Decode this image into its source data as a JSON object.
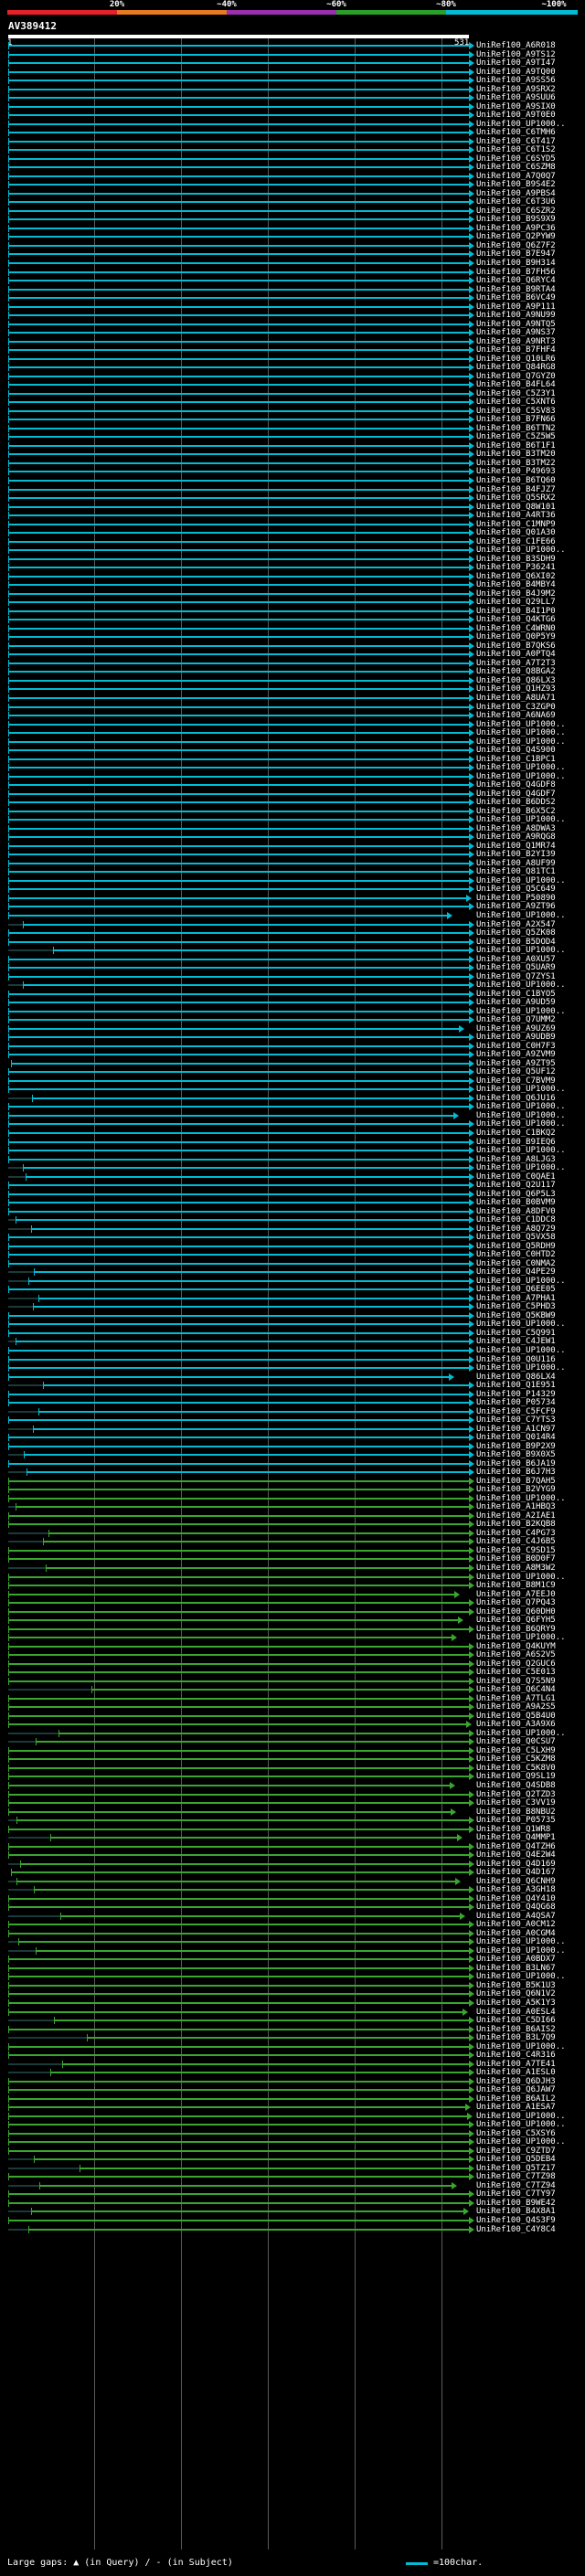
{
  "scale": {
    "marks": [
      "20%",
      "~40%",
      "~60%",
      "~80%",
      "~100%"
    ],
    "segments": [
      {
        "color": "#e8202a"
      },
      {
        "color": "#e87a1f"
      },
      {
        "color": "#9c2fb0"
      },
      {
        "color": "#2aa02a"
      },
      {
        "color": "#00bcd4"
      }
    ]
  },
  "query": {
    "title": "AV389412",
    "start": "1",
    "end": "531"
  },
  "colors": {
    "high": "#00bcd4",
    "mid": "#3aa630",
    "background": "#000000",
    "grid": "#5a5a5a"
  },
  "hits": [
    "UniRef100_A6R018",
    "UniRef100_A9TS12",
    "UniRef100_A9TI47",
    "UniRef100_A9TQ00",
    "UniRef100_A9SS56",
    "UniRef100_A9SRX2",
    "UniRef100_A9SUU6",
    "UniRef100_A9SIX0",
    "UniRef100_A9T0E0",
    "UniRef100_UP1000..",
    "UniRef100_C6TMH6",
    "UniRef100_C6T417",
    "UniRef100_C6T1S2",
    "UniRef100_C6SYD5",
    "UniRef100_C6SZM8",
    "UniRef100_A7Q0Q7",
    "UniRef100_B9S4E2",
    "UniRef100_A9PBS4",
    "UniRef100_C6T3U6",
    "UniRef100_C6SZR2",
    "UniRef100_B9S9X9",
    "UniRef100_A9PC36",
    "UniRef100_Q2PYW9",
    "UniRef100_Q6Z7F2",
    "UniRef100_B7E947",
    "UniRef100_B9H314",
    "UniRef100_B7FH56",
    "UniRef100_Q6RYC4",
    "UniRef100_B9RTA4",
    "UniRef100_B6VC49",
    "UniRef100_A9P111",
    "UniRef100_A9NU99",
    "UniRef100_A9NTQ5",
    "UniRef100_A9NS37",
    "UniRef100_A9NRT3",
    "UniRef100_B7FHF4",
    "UniRef100_Q10LR6",
    "UniRef100_Q84RG8",
    "UniRef100_Q7GYZ0",
    "UniRef100_B4FL64",
    "UniRef100_C5Z3Y1",
    "UniRef100_C5XNT6",
    "UniRef100_C5SV83",
    "UniRef100_B7FN66",
    "UniRef100_B6TTN2",
    "UniRef100_C5Z5W5",
    "UniRef100_B6T1F1",
    "UniRef100_B3TM20",
    "UniRef100_B3TM22",
    "UniRef100_P49693",
    "UniRef100_B6TQ60",
    "UniRef100_B4FJZ7",
    "UniRef100_Q5SRX2",
    "UniRef100_Q8W101",
    "UniRef100_A4RT36",
    "UniRef100_C1MNP9",
    "UniRef100_Q01A30",
    "UniRef100_C1FE66",
    "UniRef100_UP1000..",
    "UniRef100_B3SDH9",
    "UniRef100_P36241",
    "UniRef100_Q6XI02",
    "UniRef100_B4MBY4",
    "UniRef100_B4J9M2",
    "UniRef100_Q29LL7",
    "UniRef100_B4I1P0",
    "UniRef100_Q4KTG6",
    "UniRef100_C4WRN0",
    "UniRef100_Q0P5Y9",
    "UniRef100_B7QKS6",
    "UniRef100_A0PTQ4",
    "UniRef100_A7T2T3",
    "UniRef100_Q8BGA2",
    "UniRef100_Q86LX3",
    "UniRef100_Q1HZ93",
    "UniRef100_A8UA71",
    "UniRef100_C3ZGP0",
    "UniRef100_A6NA69",
    "UniRef100_UP1000..",
    "UniRef100_UP1000..",
    "UniRef100_UP1000..",
    "UniRef100_Q4S900",
    "UniRef100_C1BPC1",
    "UniRef100_UP1000..",
    "UniRef100_UP1000..",
    "UniRef100_Q4GDF8",
    "UniRef100_Q4GDF7",
    "UniRef100_B6DDS2",
    "UniRef100_B6X5C2",
    "UniRef100_UP1000..",
    "UniRef100_A8DWA3",
    "UniRef100_A9RQG8",
    "UniRef100_Q1MR74",
    "UniRef100_B2YI39",
    "UniRef100_A8UF99",
    "UniRef100_Q81TC1",
    "UniRef100_UP1000..",
    "UniRef100_Q5C649",
    "UniRef100_P50890",
    "UniRef100_A9ZT96",
    "UniRef100_UP1000..",
    "UniRef100_A2X547",
    "UniRef100_Q5ZK08",
    "UniRef100_B5DOD4",
    "UniRef100_UP1000..",
    "UniRef100_A0XU57",
    "UniRef100_Q5UAR9",
    "UniRef100_Q7ZYS1",
    "UniRef100_UP1000..",
    "UniRef100_C1BYO5",
    "UniRef100_A9UD59",
    "UniRef100_UP1000..",
    "UniRef100_Q7UMM2",
    "UniRef100_A9UZ69",
    "UniRef100_A9UDB9",
    "UniRef100_C0H7F3",
    "UniRef100_A9ZVM9",
    "UniRef100_A9ZT95",
    "UniRef100_Q5UF12",
    "UniRef100_C7BVM9",
    "UniRef100_UP1000..",
    "UniRef100_Q6JU16",
    "UniRef100_UP1000..",
    "UniRef100_UP1000..",
    "UniRef100_UP1000..",
    "UniRef100_C1BKQ2",
    "UniRef100_B9IEQ6",
    "UniRef100_UP1000..",
    "UniRef100_A8LJG3",
    "UniRef100_UP1000..",
    "UniRef100_C0QAE1",
    "UniRef100_Q2U117",
    "UniRef100_Q6P5L3",
    "UniRef100_B0BVM9",
    "UniRef100_A8DFV0",
    "UniRef100_C1DDC8",
    "UniRef100_A8Q729",
    "UniRef100_Q5VX58",
    "UniRef100_Q5RDH9",
    "UniRef100_C0HTD2",
    "UniRef100_C0NMA2",
    "UniRef100_Q4PE29",
    "UniRef100_UP1000..",
    "UniRef100_Q6EE05",
    "UniRef100_A7PHA1",
    "UniRef100_C5PHD3",
    "UniRef100_Q5KBW9",
    "UniRef100_UP1000..",
    "UniRef100_C5Q991",
    "UniRef100_C4JEW1",
    "UniRef100_UP1000..",
    "UniRef100_Q0U116",
    "UniRef100_UP1000..",
    "UniRef100_Q86LX4",
    "UniRef100_Q1E951",
    "UniRef100_P14329",
    "UniRef100_P05734",
    "UniRef100_C5FCF9",
    "UniRef100_C7YTS3",
    "UniRef100_A1CN97",
    "UniRef100_Q014R4",
    "UniRef100_B9P2X9",
    "UniRef100_B9X0X5",
    "UniRef100_B6JA19",
    "UniRef100_B6J7H3",
    "UniRef100_B7QAH5",
    "UniRef100_B2VYG9",
    "UniRef100_UP1000..",
    "UniRef100_A1HBQ3",
    "UniRef100_A2IAE1",
    "UniRef100_B2KQB8",
    "UniRef100_C4PG73",
    "UniRef100_C4J6B5",
    "UniRef100_C9SD15",
    "UniRef100_B0D0F7",
    "UniRef100_A8M3W2",
    "UniRef100_UP1000..",
    "UniRef100_B8M1C9",
    "UniRef100_A7EEJ0",
    "UniRef100_Q7PQ43",
    "UniRef100_Q60DH0",
    "UniRef100_Q6FYH5",
    "UniRef100_B6QRY9",
    "UniRef100_UP1000..",
    "UniRef100_Q4KUYM",
    "UniRef100_A6S2V5",
    "UniRef100_Q2GUC6",
    "UniRef100_C5E013",
    "UniRef100_Q7S5N9",
    "UniRef100_Q6C4N4",
    "UniRef100_A7TLG1",
    "UniRef100_A9A2S5",
    "UniRef100_Q5B4U0",
    "UniRef100_A3A9X6",
    "UniRef100_UP1000..",
    "UniRef100_Q0CSU7",
    "UniRef100_C5LXH9",
    "UniRef100_C5KZM8",
    "UniRef100_C5K8V0",
    "UniRef100_Q9SL19",
    "UniRef100_Q4SDB8",
    "UniRef100_Q2TZD3",
    "UniRef100_C3VV19",
    "UniRef100_B8NBU2",
    "UniRef100_P05735",
    "UniRef100_Q1WR8",
    "UniRef100_Q4MMP1",
    "UniRef100_Q4TZH6",
    "UniRef100_Q4E2W4",
    "UniRef100_Q4D169",
    "UniRef100_Q4D167",
    "UniRef100_Q6CNH9",
    "UniRef100_A3GH18",
    "UniRef100_Q4Y410",
    "UniRef100_Q4QG68",
    "UniRef100_A4QSA7",
    "UniRef100_A0CM12",
    "UniRef100_A0CGM4",
    "UniRef100_UP1000..",
    "UniRef100_UP1000..",
    "UniRef100_A0BDX7",
    "UniRef100_B3LN67",
    "UniRef100_UP1000..",
    "UniRef100_B5K1U3",
    "UniRef100_Q6N1V2",
    "UniRef100_A5K1Y3",
    "UniRef100_A0ESL4",
    "UniRef100_C5DI66",
    "UniRef100_B6AIS2",
    "UniRef100_B3L7Q9",
    "UniRef100_UP1000..",
    "UniRef100_C4R316",
    "UniRef100_A7TE41",
    "UniRef100_A1ESL0",
    "UniRef100_Q6DJH3",
    "UniRef100_Q6JAW7",
    "UniRef100_B6AIL2",
    "UniRef100_A1ESA7",
    "UniRef100_UP1000..",
    "UniRef100_UP1000..",
    "UniRef100_C5XSY6",
    "UniRef100_UP1000..",
    "UniRef100_C9ZTD7",
    "UniRef100_Q5DEB4",
    "UniRef100_Q5TZ17",
    "UniRef100_C7TZ98",
    "UniRef100_C7TZ94",
    "UniRef100_C7TY97",
    "UniRef100_B9WE42",
    "UniRef100_B4X8A1",
    "UniRef100_Q4S3F9",
    "UniRef100_C4Y8C4"
  ],
  "legend": {
    "gaps_text": "Large gaps: ▲ (in Query) / - (in Subject)",
    "unit_text": "=100char."
  }
}
